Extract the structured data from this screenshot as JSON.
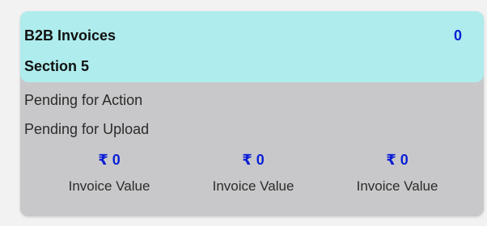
{
  "card": {
    "title": "B2B Invoices",
    "count": "0",
    "section": "Section 5",
    "rows": [
      {
        "label": "Pending for Action"
      },
      {
        "label": "Pending for Upload"
      }
    ],
    "metrics": [
      {
        "value": "₹ 0",
        "label": "Invoice Value"
      },
      {
        "value": "₹ 0",
        "label": "Invoice Value"
      },
      {
        "value": "₹ 0",
        "label": "Invoice Value"
      }
    ]
  },
  "colors": {
    "header_bg": "#aeeced",
    "card_bg": "#c8c8ca",
    "accent_blue": "#0a1fd6"
  }
}
